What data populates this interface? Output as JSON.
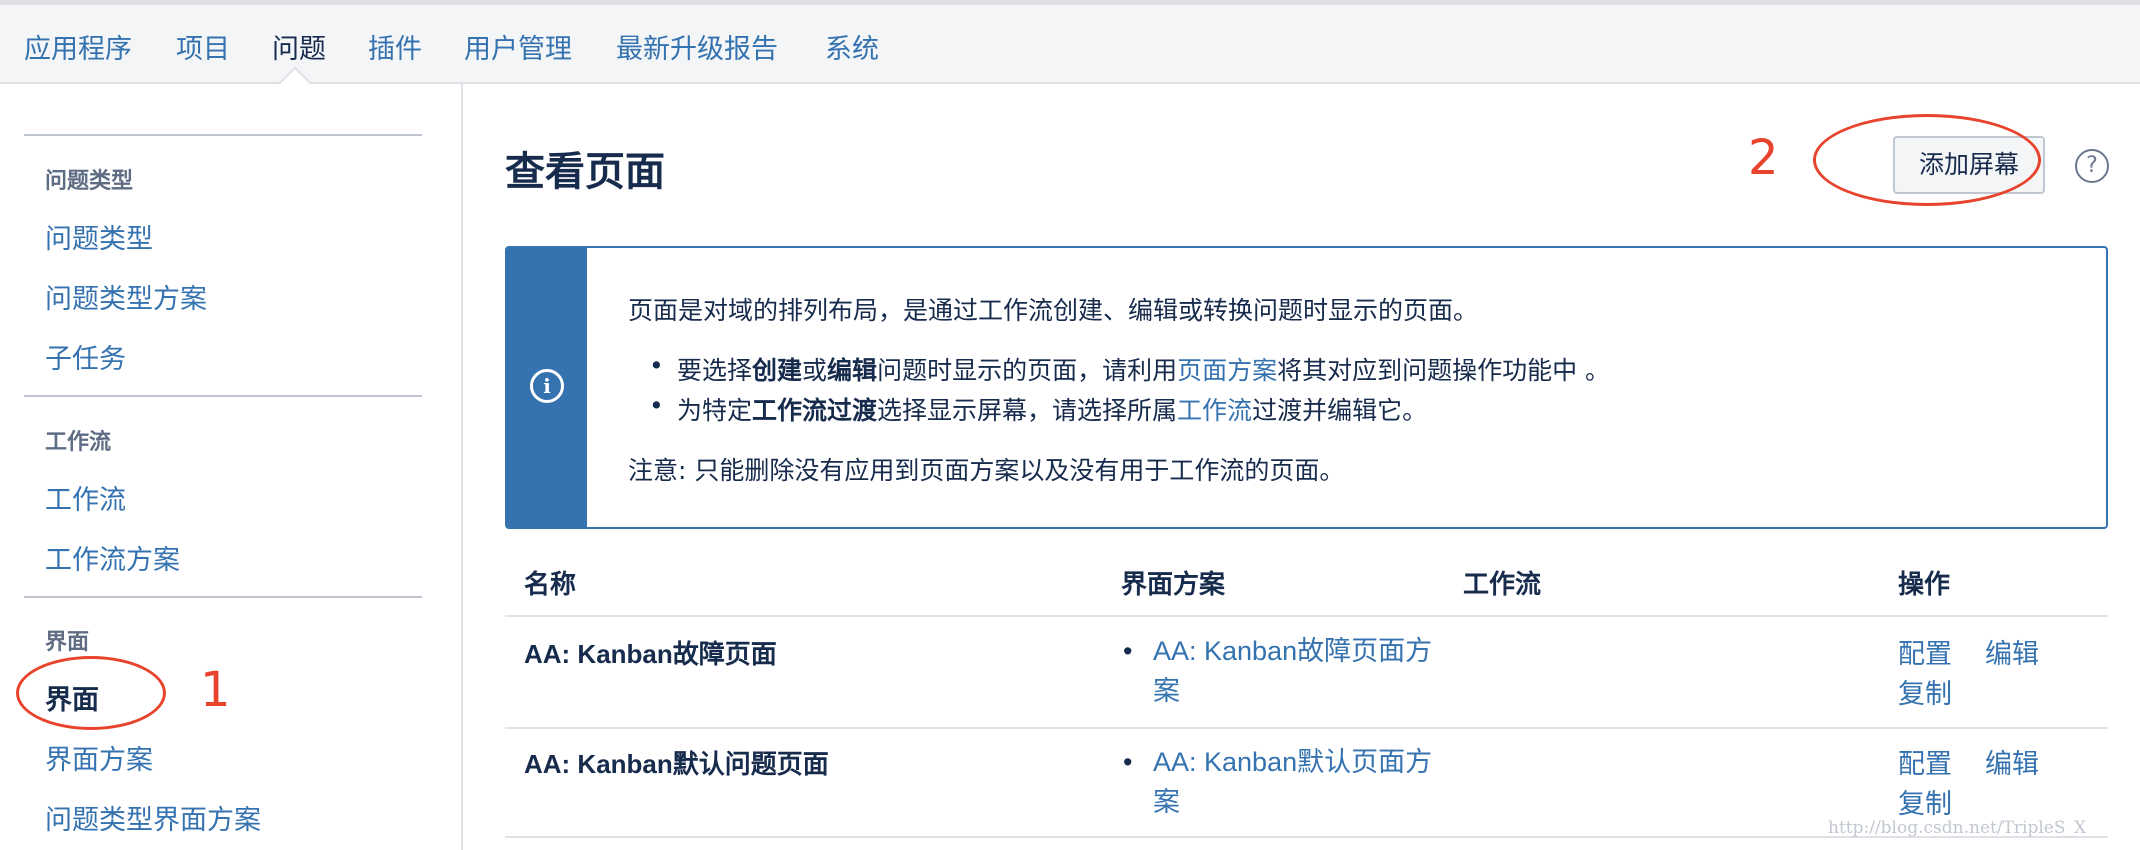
{
  "topnav": {
    "tabs": [
      "应用程序",
      "项目",
      "问题",
      "插件",
      "用户管理",
      "最新升级报告",
      "系统"
    ]
  },
  "sidebar": {
    "sections": [
      {
        "heading": "问题类型",
        "items": [
          "问题类型",
          "问题类型方案",
          "子任务"
        ]
      },
      {
        "heading": "工作流",
        "items": [
          "工作流",
          "工作流方案"
        ]
      },
      {
        "heading": "界面",
        "items": [
          "界面",
          "界面方案",
          "问题类型界面方案"
        ]
      }
    ]
  },
  "main": {
    "title": "查看页面",
    "add_button": "添加屏幕",
    "help": "?",
    "info": {
      "icon": "i",
      "intro": "页面是对域的排列布局，是通过工作流创建、编辑或转换问题时显示的页面。",
      "bullet1": {
        "t1": "要选择",
        "b1": "创建",
        "t2": "或",
        "b2": "编辑",
        "t3": "问题时显示的页面，请利用",
        "link": "页面方案",
        "t4": "将其对应到问题操作功能中 。"
      },
      "bullet2": {
        "t1": "为特定",
        "b1": "工作流过渡",
        "t2": "选择显示屏幕，请选择所属",
        "link": "工作流",
        "t3": "过渡并编辑它。"
      },
      "note": "注意: 只能删除没有应用到页面方案以及没有用于工作流的页面。"
    },
    "table": {
      "headers": [
        "名称",
        "界面方案",
        "工作流",
        "操作"
      ],
      "rows": [
        {
          "name": "AA: Kanban故障页面",
          "scheme": "AA: Kanban故障页面方案",
          "actions": [
            "配置",
            "编辑",
            "复制"
          ]
        },
        {
          "name": "AA: Kanban默认问题页面",
          "scheme": "AA: Kanban默认页面方案",
          "actions": [
            "配置",
            "编辑",
            "复制"
          ]
        }
      ]
    }
  },
  "annotations": {
    "one": "1",
    "two": "2"
  },
  "watermark": "http://blog.csdn.net/TripleS_X"
}
